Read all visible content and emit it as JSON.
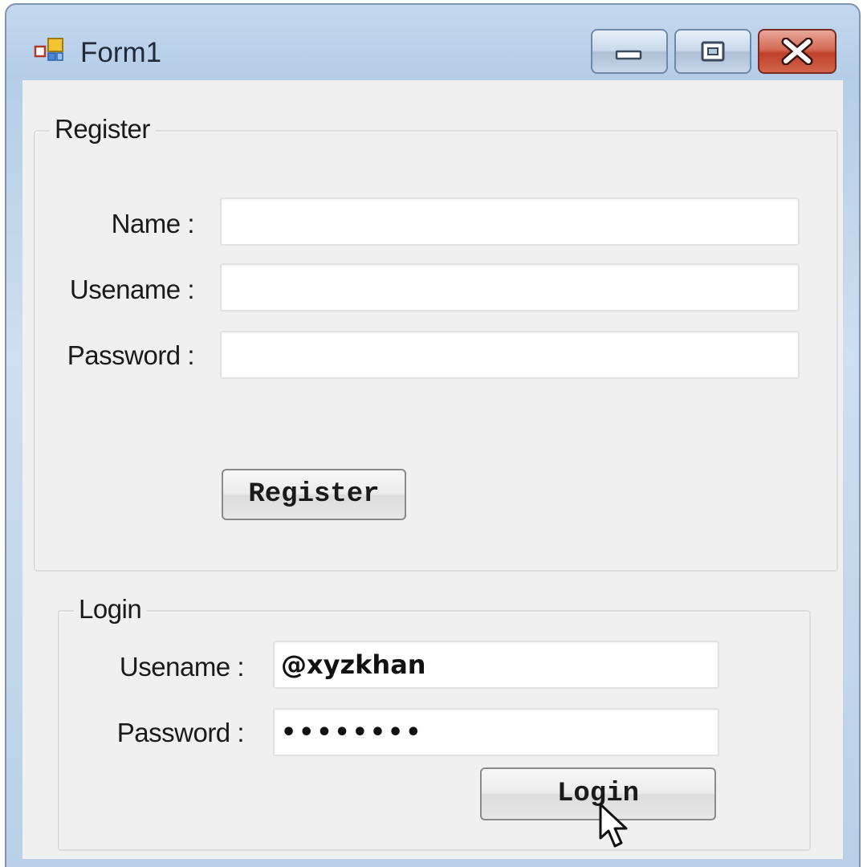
{
  "window": {
    "title": "Form1",
    "controls": {
      "minimize": "minimize",
      "maximize": "maximize",
      "close": "close"
    }
  },
  "register": {
    "group_label": "Register",
    "name_label": "Name :",
    "name_value": "",
    "username_label": "Usename :",
    "username_value": "",
    "password_label": "Password :",
    "password_value": "",
    "button_label": "Register"
  },
  "login": {
    "group_label": "Login",
    "username_label": "Usename :",
    "username_value": "@xyzkhan",
    "password_label": "Password :",
    "password_mask": "••••••••",
    "button_label": "Login"
  },
  "icons": {
    "app": "form-app-icon",
    "minimize": "minimize-icon",
    "maximize": "maximize-icon",
    "close": "close-icon",
    "cursor": "mouse-pointer-icon"
  },
  "colors": {
    "titlebar": "#c3d9ef",
    "client_bg": "#f0f0f0",
    "close_button": "#d46a55"
  }
}
